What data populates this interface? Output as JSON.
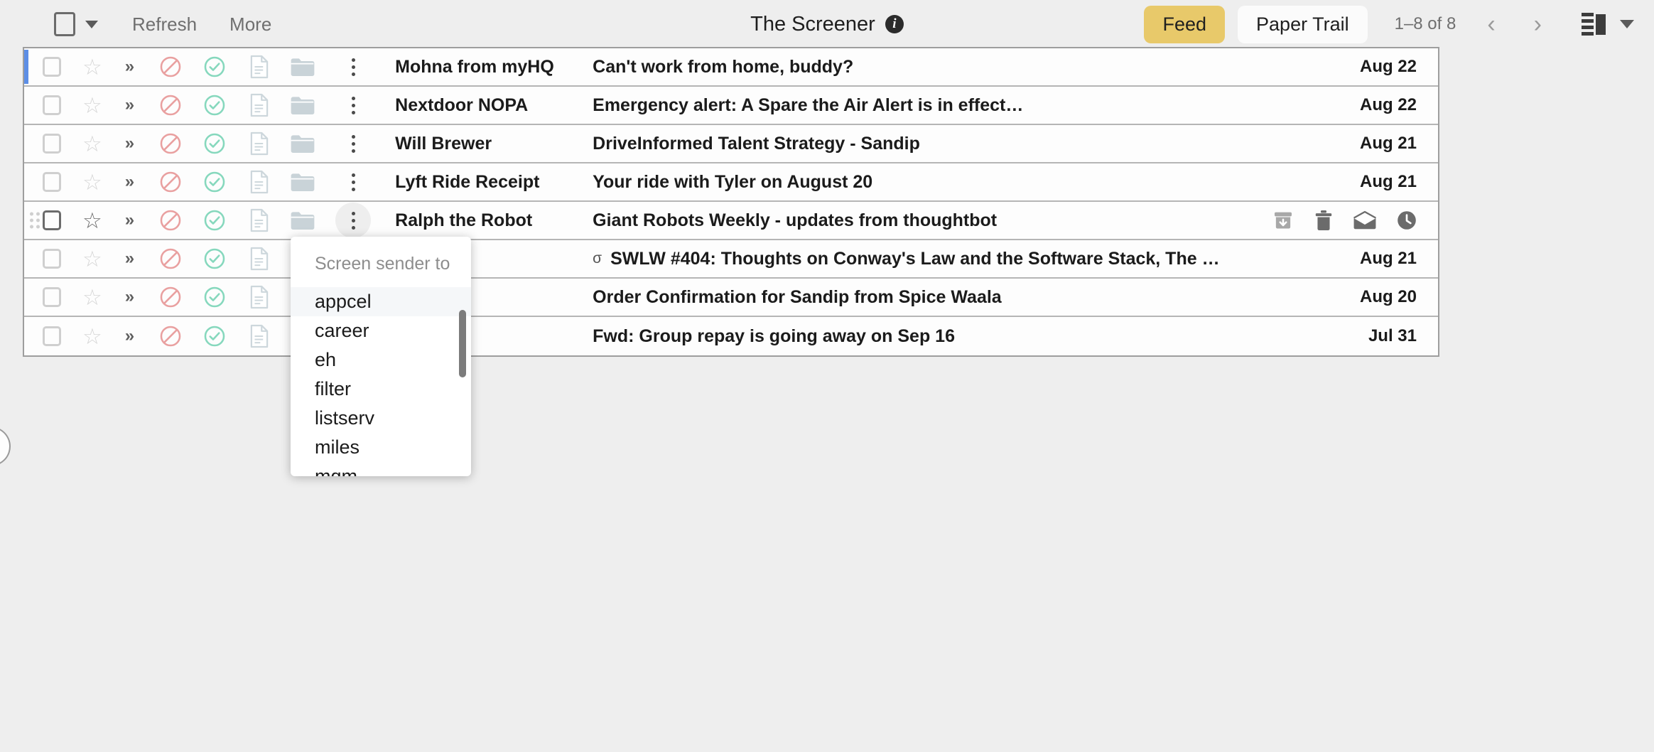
{
  "toolbar": {
    "select_all_label": "",
    "refresh_label": "Refresh",
    "more_label": "More",
    "app_title": "The Screener",
    "info_glyph": "i",
    "feed_label": "Feed",
    "paper_trail_label": "Paper Trail",
    "count_label": "1–8 of 8",
    "prev_glyph": "‹",
    "next_glyph": "›",
    "feed_color": "#e8c96a",
    "accent_color": "#5c8ee6"
  },
  "row_icons": {
    "star_glyph": "☆",
    "chevrons_glyph": "»"
  },
  "messages": [
    {
      "sender": "Mohna from myHQ",
      "subject": "Can't work from home, buddy?",
      "date": "Aug 22",
      "mark": "",
      "selected": true,
      "hovered": false
    },
    {
      "sender": "Nextdoor NOPA",
      "subject": "Emergency alert: A Spare the Air Alert is in effect…",
      "date": "Aug 22",
      "mark": "",
      "selected": false,
      "hovered": false
    },
    {
      "sender": "Will Brewer",
      "subject": "DriveInformed Talent Strategy - Sandip",
      "date": "Aug 21",
      "mark": "",
      "selected": false,
      "hovered": false
    },
    {
      "sender": "Lyft Ride Receipt",
      "subject": "Your ride with Tyler on August 20",
      "date": "Aug 21",
      "mark": "",
      "selected": false,
      "hovered": false
    },
    {
      "sender": "Ralph the Robot",
      "subject": "Giant Robots Weekly - updates from thoughtbot",
      "date": "",
      "mark": "",
      "selected": false,
      "hovered": true
    },
    {
      "sender": "",
      "subject": "SWLW #404: Thoughts on Conway's Law and the Software Stack, The …",
      "date": "Aug 21",
      "mark": "σ",
      "selected": false,
      "hovered": false
    },
    {
      "sender": "",
      "subject": "Order Confirmation for Sandip from Spice Waala",
      "date": "Aug 20",
      "mark": "",
      "selected": false,
      "hovered": false
    },
    {
      "sender": "",
      "subject": "Fwd: Group repay is going away on Sep 16",
      "date": "Jul 31",
      "mark": "",
      "selected": false,
      "hovered": false
    }
  ],
  "hover_actions": [
    {
      "name": "archive-icon"
    },
    {
      "name": "delete-icon"
    },
    {
      "name": "mark-read-icon"
    },
    {
      "name": "snooze-icon"
    }
  ],
  "dropdown": {
    "header": "Screen sender to",
    "items": [
      {
        "label": "appcel",
        "selected": true
      },
      {
        "label": "career",
        "selected": false
      },
      {
        "label": "eh",
        "selected": false
      },
      {
        "label": "filter",
        "selected": false
      },
      {
        "label": "listserv",
        "selected": false
      },
      {
        "label": "miles",
        "selected": false
      },
      {
        "label": "mqm",
        "selected": false
      }
    ]
  }
}
